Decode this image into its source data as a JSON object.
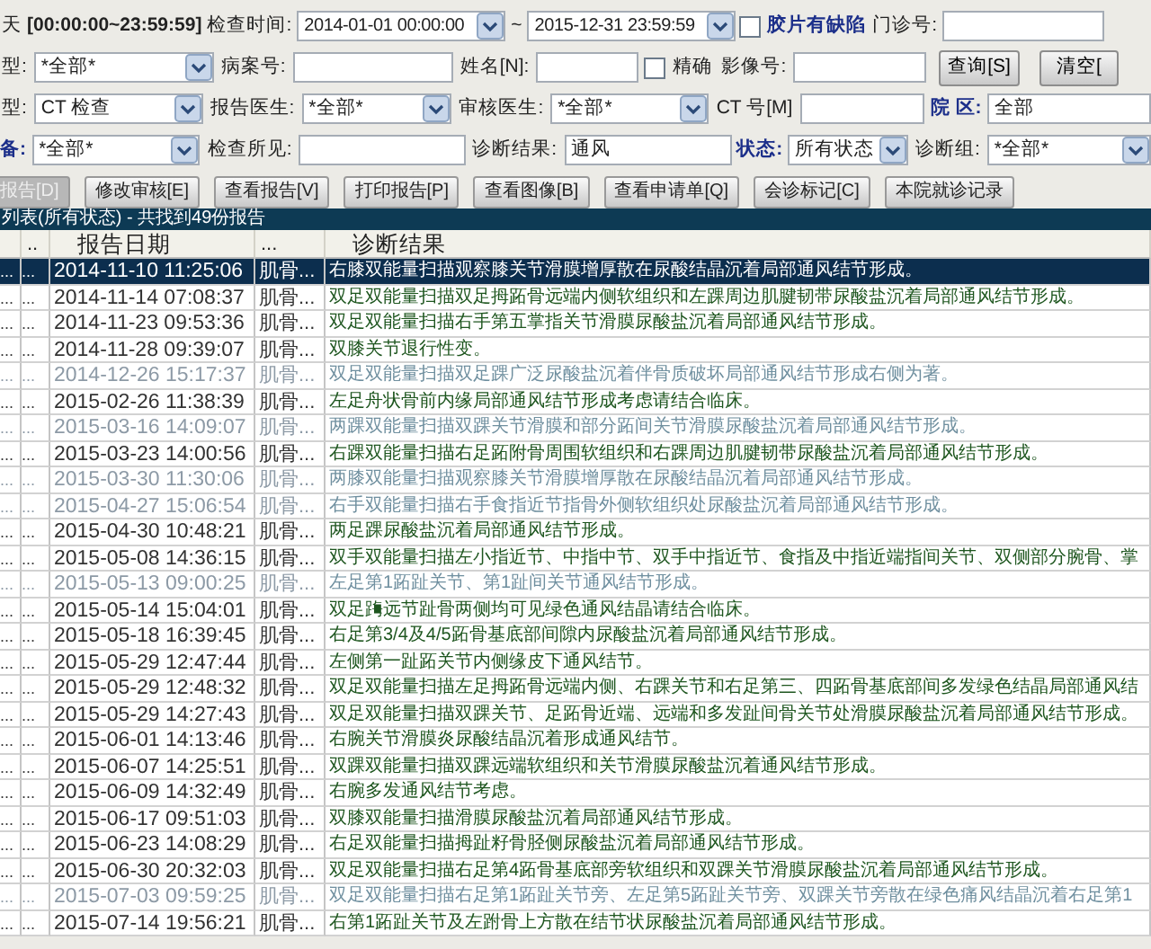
{
  "filters": [
    [
      {
        "kind": "label",
        "text": "天"
      },
      {
        "kind": "strong",
        "text": "[00:00:00~23:59:59]"
      },
      {
        "kind": "label",
        "text": "检查时间:"
      },
      {
        "kind": "select",
        "value": "2014-01-01 00:00:00"
      },
      {
        "kind": "label",
        "text": "~"
      },
      {
        "kind": "select",
        "value": "2015-12-31 23:59:59"
      },
      {
        "kind": "checkbox",
        "text": "胶片有缺陷",
        "checked": false,
        "strong": true
      },
      {
        "kind": "label",
        "text": "门诊号:"
      },
      {
        "kind": "input"
      }
    ],
    [
      {
        "kind": "label",
        "text": "型:"
      },
      {
        "kind": "select",
        "value": "*全部*"
      },
      {
        "kind": "label",
        "text": "病案号:"
      },
      {
        "kind": "input"
      },
      {
        "kind": "label",
        "text": "姓名[N]:"
      },
      {
        "kind": "input"
      },
      {
        "kind": "checkbox",
        "text": "精确",
        "checked": false,
        "strong": false
      },
      {
        "kind": "label",
        "text": "影像号:"
      },
      {
        "kind": "input"
      },
      {
        "kind": "button",
        "text": "查询[S]"
      },
      {
        "kind": "button",
        "text": "清空["
      }
    ],
    [
      {
        "kind": "label",
        "text": "型:"
      },
      {
        "kind": "select",
        "value": "CT 检查"
      },
      {
        "kind": "label",
        "text": "报告医生:"
      },
      {
        "kind": "select",
        "value": "*全部*"
      },
      {
        "kind": "label",
        "text": "审核医生:"
      },
      {
        "kind": "select",
        "value": "*全部*"
      },
      {
        "kind": "label",
        "text": "CT 号[M]"
      },
      {
        "kind": "input"
      },
      {
        "kind": "accent",
        "text": "院 区:"
      },
      {
        "kind": "input",
        "value": "全部"
      }
    ],
    [
      {
        "kind": "accent",
        "text": "备:"
      },
      {
        "kind": "select",
        "value": "*全部*"
      },
      {
        "kind": "label",
        "text": "检查所见:"
      },
      {
        "kind": "input"
      },
      {
        "kind": "label",
        "text": "诊断结果:"
      },
      {
        "kind": "input",
        "value": "通风"
      },
      {
        "kind": "accent",
        "text": "状态:"
      },
      {
        "kind": "select",
        "value": "所有状态"
      },
      {
        "kind": "label",
        "text": "诊断组:"
      },
      {
        "kind": "select",
        "value": "*全部*"
      }
    ]
  ],
  "toolbar": [
    {
      "label": "报告[D]",
      "disabled": true
    },
    {
      "label": "修改审核[E]",
      "disabled": false
    },
    {
      "label": "查看报告[V]",
      "disabled": false
    },
    {
      "label": "打印报告[P]",
      "disabled": false
    },
    {
      "label": "查看图像[B]",
      "disabled": false
    },
    {
      "label": "查看申请单[Q]",
      "disabled": false
    },
    {
      "label": "会诊标记[C]",
      "disabled": false
    },
    {
      "label": "本院就诊记录",
      "disabled": false
    }
  ],
  "list_title": "列表(所有状态) - 共找到49份报告",
  "table": {
    "columns": [
      "..",
      "报告日期",
      "...",
      "诊断结果"
    ],
    "rows": [
      {
        "c1": "...",
        "c2": "...",
        "date": "2014-11-10 11:25:06",
        "category": "肌骨...",
        "diagnosis": "右膝双能量扫描观察膝关节滑膜增厚散在尿酸结晶沉着局部通风结节形成。",
        "selected": true,
        "dim": false
      },
      {
        "c1": "...",
        "c2": "...",
        "date": "2014-11-14 07:08:37",
        "category": "肌骨...",
        "diagnosis": "双足双能量扫描双足拇跖骨远端内侧软组织和左踝周边肌腱韧带尿酸盐沉着局部通风结节形成。",
        "selected": false,
        "dim": false
      },
      {
        "c1": "...",
        "c2": "...",
        "date": "2014-11-23 09:53:36",
        "category": "肌骨...",
        "diagnosis": "双足双能量扫描右手第五掌指关节滑膜尿酸盐沉着局部通风结节形成。",
        "selected": false,
        "dim": false
      },
      {
        "c1": "...",
        "c2": "...",
        "date": "2014-11-28 09:39:07",
        "category": "肌骨...",
        "diagnosis": "双膝关节退行性变。",
        "selected": false,
        "dim": false
      },
      {
        "c1": "...",
        "c2": "...",
        "date": "2014-12-26 15:17:37",
        "category": "肌骨...",
        "diagnosis": "双足双能量扫描双足踝广泛尿酸盐沉着伴骨质破坏局部通风结节形成右侧为著。",
        "selected": false,
        "dim": true
      },
      {
        "c1": "...",
        "c2": "...",
        "date": "2015-02-26 11:38:39",
        "category": "肌骨...",
        "diagnosis": "左足舟状骨前内缘局部通风结节形成考虑请结合临床。",
        "selected": false,
        "dim": false
      },
      {
        "c1": "...",
        "c2": "...",
        "date": "2015-03-16 14:09:07",
        "category": "肌骨...",
        "diagnosis": "两踝双能量扫描双踝关节滑膜和部分跖间关节滑膜尿酸盐沉着局部通风结节形成。",
        "selected": false,
        "dim": true
      },
      {
        "c1": "...",
        "c2": "...",
        "date": "2015-03-23 14:00:56",
        "category": "肌骨...",
        "diagnosis": "右踝双能量扫描右足跖附骨周围软组织和右踝周边肌腱韧带尿酸盐沉着局部通风结节形成。",
        "selected": false,
        "dim": false
      },
      {
        "c1": "...",
        "c2": "...",
        "date": "2015-03-30 11:30:06",
        "category": "肌骨...",
        "diagnosis": "两膝双能量扫描观察膝关节滑膜增厚散在尿酸结晶沉着局部通风结节形成。",
        "selected": false,
        "dim": true
      },
      {
        "c1": "...",
        "c2": "...",
        "date": "2015-04-27 15:06:54",
        "category": "肌骨...",
        "diagnosis": "右手双能量扫描右手食指近节指骨外侧软组织处尿酸盐沉着局部通风结节形成。",
        "selected": false,
        "dim": true
      },
      {
        "c1": "...",
        "c2": "...",
        "date": "2015-04-30 10:48:21",
        "category": "肌骨...",
        "diagnosis": "两足踝尿酸盐沉着局部通风结节形成。",
        "selected": false,
        "dim": false
      },
      {
        "c1": "...",
        "c2": "...",
        "date": "2015-05-08 14:36:15",
        "category": "肌骨...",
        "diagnosis": "双手双能量扫描左小指近节、中指中节、双手中指近节、食指及中指近端指间关节、双侧部分腕骨、掌",
        "selected": false,
        "dim": false
      },
      {
        "c1": "...",
        "c2": "...",
        "date": "2015-05-13 09:00:25",
        "category": "肌骨...",
        "diagnosis": "左足第1跖趾关节、第1趾间关节通风结节形成。",
        "selected": false,
        "dim": true
      },
      {
        "c1": "...",
        "c2": "...",
        "date": "2015-05-14 15:04:01",
        "category": "肌骨...",
        "diagnosis": "双足踇远节趾骨两侧均可见绿色通风结晶请结合临床。",
        "selected": false,
        "dim": false
      },
      {
        "c1": "...",
        "c2": "...",
        "date": "2015-05-18 16:39:45",
        "category": "肌骨...",
        "diagnosis": "右足第3/4及4/5跖骨基底部间隙内尿酸盐沉着局部通风结节形成。",
        "selected": false,
        "dim": false
      },
      {
        "c1": "...",
        "c2": "...",
        "date": "2015-05-29 12:47:44",
        "category": "肌骨...",
        "diagnosis": "左侧第一趾跖关节内侧缘皮下通风结节。",
        "selected": false,
        "dim": false
      },
      {
        "c1": "...",
        "c2": "...",
        "date": "2015-05-29 12:48:32",
        "category": "肌骨...",
        "diagnosis": "双足双能量扫描左足拇跖骨远端内侧、右踝关节和右足第三、四跖骨基底部间多发绿色结晶局部通风结",
        "selected": false,
        "dim": false
      },
      {
        "c1": "...",
        "c2": "...",
        "date": "2015-05-29 14:27:43",
        "category": "肌骨...",
        "diagnosis": "双足双能量扫描双踝关节、足跖骨近端、远端和多发趾间骨关节处滑膜尿酸盐沉着局部通风结节形成。",
        "selected": false,
        "dim": false
      },
      {
        "c1": "...",
        "c2": "...",
        "date": "2015-06-01 14:13:46",
        "category": "肌骨...",
        "diagnosis": "右腕关节滑膜炎尿酸结晶沉着形成通风结节。",
        "selected": false,
        "dim": false
      },
      {
        "c1": "...",
        "c2": "...",
        "date": "2015-06-07 14:25:51",
        "category": "肌骨...",
        "diagnosis": "双踝双能量扫描双踝远端软组织和关节滑膜尿酸盐沉着通风结节形成。",
        "selected": false,
        "dim": false
      },
      {
        "c1": "...",
        "c2": "...",
        "date": "2015-06-09 14:32:49",
        "category": "肌骨...",
        "diagnosis": "右腕多发通风结节考虑。",
        "selected": false,
        "dim": false
      },
      {
        "c1": "...",
        "c2": "...",
        "date": "2015-06-17 09:51:03",
        "category": "肌骨...",
        "diagnosis": "双膝双能量扫描滑膜尿酸盐沉着局部通风结节形成。",
        "selected": false,
        "dim": false
      },
      {
        "c1": "...",
        "c2": "...",
        "date": "2015-06-23 14:08:29",
        "category": "肌骨...",
        "diagnosis": "右足双能量扫描拇趾籽骨胫侧尿酸盐沉着局部通风结节形成。",
        "selected": false,
        "dim": false
      },
      {
        "c1": "...",
        "c2": "...",
        "date": "2015-06-30 20:32:03",
        "category": "肌骨...",
        "diagnosis": "双足双能量扫描右足第4跖骨基底部旁软组织和双踝关节滑膜尿酸盐沉着局部通风结节形成。",
        "selected": false,
        "dim": false
      },
      {
        "c1": "...",
        "c2": "...",
        "date": "2015-07-03 09:59:25",
        "category": "肌骨...",
        "diagnosis": "双足双能量扫描右足第1跖趾关节旁、左足第5跖趾关节旁、双踝关节旁散在绿色痛风结晶沉着右足第1",
        "selected": false,
        "dim": true
      },
      {
        "c1": "...",
        "c2": "...",
        "date": "2015-07-14 19:56:21",
        "category": "肌骨...",
        "diagnosis": "右第1跖趾关节及左跗骨上方散在结节状尿酸盐沉着局部通风结节形成。",
        "selected": false,
        "dim": false
      }
    ]
  }
}
